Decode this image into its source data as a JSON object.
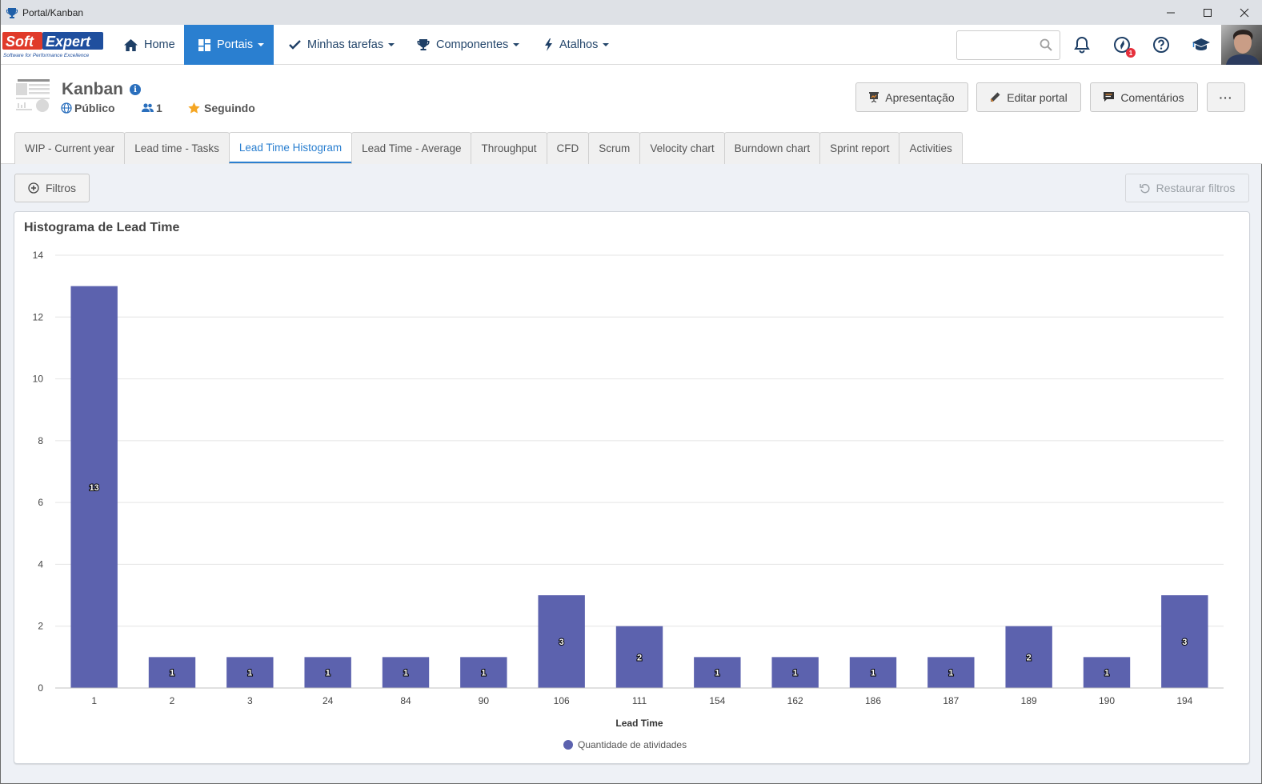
{
  "window": {
    "title": "Portal/Kanban",
    "app_icon": "trophy-icon",
    "controls": [
      "minimize-icon",
      "maximize-icon",
      "close-icon"
    ]
  },
  "topnav": {
    "logo": {
      "brand_left": "Soft",
      "brand_right": "Expert",
      "tagline": "Software for Performance Excellence"
    },
    "items": [
      {
        "label": "Home",
        "icon": "home-icon",
        "dropdown": false,
        "active": false
      },
      {
        "label": "Portais",
        "icon": "dashboard-icon",
        "dropdown": true,
        "active": true
      },
      {
        "label": "Minhas tarefas",
        "icon": "check-icon",
        "dropdown": true,
        "active": false
      },
      {
        "label": "Componentes",
        "icon": "trophy-icon",
        "dropdown": true,
        "active": false
      },
      {
        "label": "Atalhos",
        "icon": "bolt-icon",
        "dropdown": true,
        "active": false
      }
    ],
    "search": {
      "value": "",
      "placeholder": ""
    },
    "notification_badge": "1",
    "accent": "#2a7fd0"
  },
  "header": {
    "title": "Kanban",
    "visibility": "Público",
    "members_count": "1",
    "following_label": "Seguindo",
    "buttons": {
      "presentation": "Apresentação",
      "edit": "Editar portal",
      "comments": "Comentários",
      "more": "···"
    }
  },
  "tabs": [
    {
      "label": "WIP - Current year",
      "active": false
    },
    {
      "label": "Lead time - Tasks",
      "active": false
    },
    {
      "label": "Lead Time Histogram",
      "active": true
    },
    {
      "label": "Lead Time - Average",
      "active": false
    },
    {
      "label": "Throughput",
      "active": false
    },
    {
      "label": "CFD",
      "active": false
    },
    {
      "label": "Scrum",
      "active": false
    },
    {
      "label": "Velocity chart",
      "active": false
    },
    {
      "label": "Burndown chart",
      "active": false
    },
    {
      "label": "Sprint report",
      "active": false
    },
    {
      "label": "Activities",
      "active": false
    }
  ],
  "filters": {
    "filter_label": "Filtros",
    "restore_label": "Restaurar filtros"
  },
  "chart_data": {
    "type": "bar",
    "title": "Histograma de Lead Time",
    "xlabel": "Lead Time",
    "ylabel": "",
    "categories": [
      "1",
      "2",
      "3",
      "24",
      "84",
      "90",
      "106",
      "111",
      "154",
      "162",
      "186",
      "187",
      "189",
      "190",
      "194"
    ],
    "series": [
      {
        "name": "Quantidade de atividades",
        "color": "#5c62ae",
        "values": [
          13,
          1,
          1,
          1,
          1,
          1,
          3,
          2,
          1,
          1,
          1,
          1,
          2,
          1,
          3
        ]
      }
    ],
    "ylim": [
      0,
      14
    ],
    "yticks": [
      0,
      2,
      4,
      6,
      8,
      10,
      12,
      14
    ],
    "grid": true,
    "data_labels": true,
    "legend_position": "bottom-center"
  }
}
